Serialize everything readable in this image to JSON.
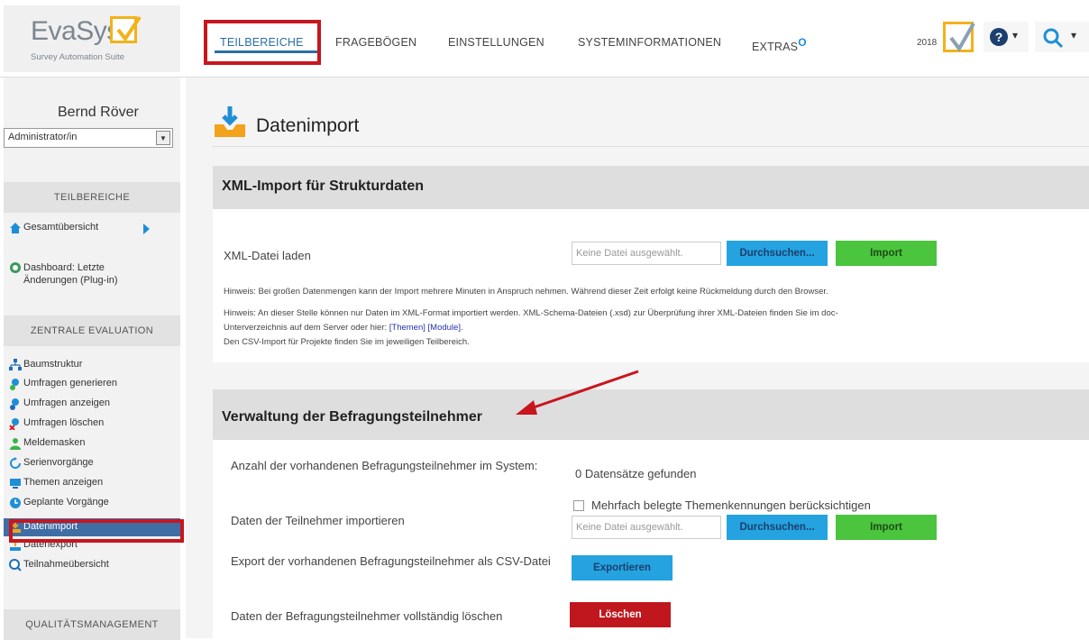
{
  "logo": {
    "brand": "EvaSys",
    "tagline": "Survey Automation Suite"
  },
  "topnav": {
    "items": [
      "TEILBEREICHE",
      "FRAGEBÖGEN",
      "EINSTELLUNGEN",
      "SYSTEMINFORMATIONEN",
      "EXTRAS"
    ],
    "extras_badge": "O",
    "year": "2018"
  },
  "user": {
    "name": "Bernd Röver",
    "role": "Administrator/in"
  },
  "sidebar": {
    "headers": [
      "TEILBEREICHE",
      "ZENTRALE EVALUATION",
      "QUALITÄTSMANAGEMENT"
    ],
    "teil_items": [
      "Gesamtübersicht",
      "Dashboard: Letzte Änderungen (Plug-in)"
    ],
    "zentral_items": [
      "Baumstruktur",
      "Umfragen generieren",
      "Umfragen anzeigen",
      "Umfragen löschen",
      "Meldemasken",
      "Serienvorgänge",
      "Themen anzeigen",
      "Geplante Vorgänge",
      "Datenimport",
      "Datenexport",
      "Teilnahmeübersicht"
    ]
  },
  "page": {
    "title": "Datenimport"
  },
  "xml_section": {
    "title": "XML-Import für Strukturdaten",
    "load_label": "XML-Datei laden",
    "file_placeholder": "Keine Datei ausgewählt.",
    "browse": "Durchsuchen...",
    "import": "Import",
    "hint1": "Hinweis: Bei großen Datenmengen kann der Import mehrere Minuten in Anspruch nehmen. Während dieser Zeit erfolgt keine Rückmeldung durch den Browser.",
    "hint2": "Hinweis: An dieser Stelle können nur Daten im XML-Format importiert werden. XML-Schema-Dateien (.xsd) zur Überprüfung ihrer XML-Dateien finden Sie im doc-",
    "hint2b": "Unterverzeichnis auf dem Server oder hier: ",
    "link_themen": "[Themen]",
    "link_module": "[Module]",
    "hint3": "Den CSV-Import für Projekte finden Sie im jeweiligen Teilbereich."
  },
  "verw_section": {
    "title": "Verwaltung der Befragungsteilnehmer",
    "count_label": "Anzahl der vorhandenen Befragungsteilnehmer im System:",
    "count_value": "0 Datensätze gefunden",
    "multi_label": "Mehrfach belegte Themenkennungen berücksichtigen",
    "import_label": "Daten der Teilnehmer importieren",
    "file_placeholder": "Keine Datei ausgewählt.",
    "browse": "Durchsuchen...",
    "import": "Import",
    "export_label": "Export der vorhandenen Befragungsteilnehmer als CSV-Datei",
    "export_btn": "Exportieren",
    "delete_label": "Daten der Befragungsteilnehmer vollständig löschen",
    "delete_btn": "Löschen"
  },
  "colors": {
    "accent": "#2b6ea8",
    "highlight_box": "#c7161e",
    "btn_blue": "#24a3e0",
    "btn_green": "#4bc43e",
    "btn_red": "#c0161d"
  }
}
